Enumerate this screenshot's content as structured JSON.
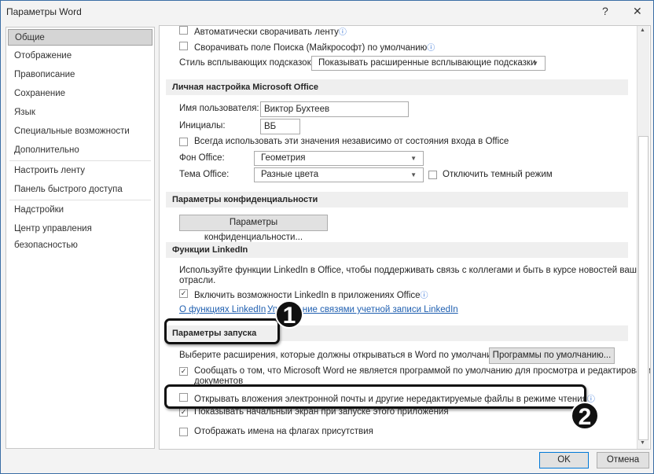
{
  "window": {
    "title": "Параметры Word",
    "help": "?",
    "close": "✕"
  },
  "sidebar": {
    "items": [
      "Общие",
      "Отображение",
      "Правописание",
      "Сохранение",
      "Язык",
      "Специальные возможности",
      "Дополнительно",
      "Настроить ленту",
      "Панель быстрого доступа",
      "Надстройки",
      "Центр управления безопасностью"
    ],
    "selected": "Общие"
  },
  "ui": {
    "auto_collapse_ribbon": {
      "label": "Автоматически сворачивать ленту",
      "checked": false
    },
    "collapse_search": {
      "label": "Сворачивать поле Поиска (Майкрософт) по умолчанию",
      "checked": false
    },
    "tooltip_style": {
      "label": "Стиль всплывающих подсказок:",
      "value": "Показывать расширенные всплывающие подсказки"
    }
  },
  "personal": {
    "header": "Личная настройка Microsoft Office",
    "username_label": "Имя пользователя:",
    "username": "Виктор Бухтеев",
    "initials_label": "Инициалы:",
    "initials": "ВБ",
    "always_use": {
      "label": "Всегда использовать эти значения независимо от состояния входа в Office",
      "checked": false
    },
    "background_label": "Фон Office:",
    "background": "Геометрия",
    "theme_label": "Тема Office:",
    "theme": "Разные цвета",
    "disable_dark": {
      "label": "Отключить темный режим",
      "checked": false
    }
  },
  "privacy": {
    "header": "Параметры конфиденциальности",
    "button": "Параметры конфиденциальности..."
  },
  "linkedin": {
    "header": "Функции LinkedIn",
    "desc1": "Используйте функции LinkedIn в Office, чтобы поддерживать связь с коллегами и быть в курсе новостей вашей",
    "desc2": "отрасли.",
    "enable": {
      "label": "Включить возможности LinkedIn в приложениях Office",
      "checked": true
    },
    "link_about": "О функциях LinkedIn",
    "link_manage": "Управление связями учетной записи LinkedIn"
  },
  "startup": {
    "header": "Параметры запуска",
    "choose_ext": "Выберите расширения, которые должны открываться в Word по умолчанию:",
    "defaults_button": "Программы по умолчанию...",
    "notify": {
      "label": "Сообщать о том, что Microsoft Word не является программой по умолчанию для просмотра и редактирования",
      "label2": "документов",
      "checked": true
    },
    "open_readonly": {
      "label": "Открывать вложения электронной почты и другие нередактируемые файлы в режиме чтения",
      "checked": false
    },
    "show_start": {
      "label": "Показывать начальный экран при запуске этого приложения",
      "checked": true
    },
    "presence": {
      "label": "Отображать имена на флагах присутствия",
      "checked": false
    }
  },
  "footer": {
    "ok": "OK",
    "cancel": "Отмена"
  },
  "annotations": [
    "1",
    "2"
  ],
  "icons": {
    "checked": "✓",
    "info": "ⓘ",
    "dropdown": "▼"
  }
}
